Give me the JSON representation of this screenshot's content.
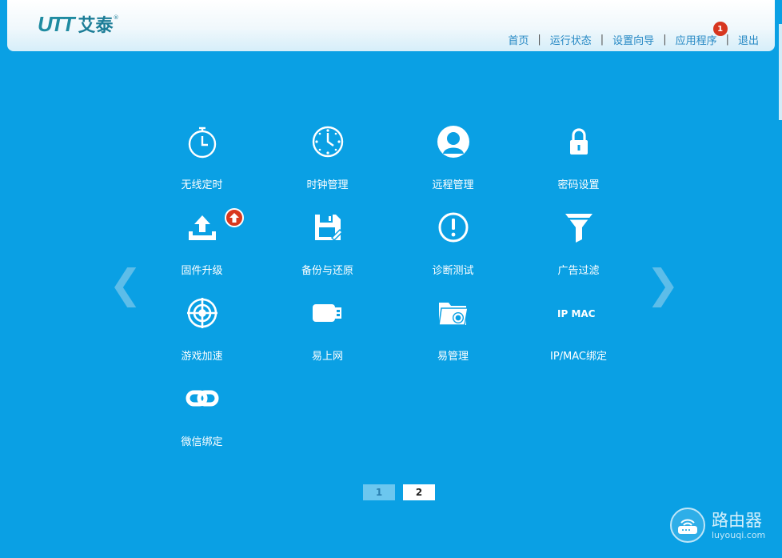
{
  "header": {
    "logo_mark": "UTT",
    "logo_text": "艾泰",
    "logo_reg": "®",
    "nav": [
      {
        "label": "首页"
      },
      {
        "label": "运行状态"
      },
      {
        "label": "设置向导"
      },
      {
        "label": "应用程序",
        "badge": "1"
      },
      {
        "label": "退出"
      }
    ]
  },
  "apps": [
    {
      "label": "无线定时",
      "icon": "stopwatch-icon"
    },
    {
      "label": "时钟管理",
      "icon": "clock-icon"
    },
    {
      "label": "远程管理",
      "icon": "user-icon"
    },
    {
      "label": "密码设置",
      "icon": "lock-icon"
    },
    {
      "label": "固件升级",
      "icon": "upload-icon"
    },
    {
      "label": "备份与还原",
      "icon": "floppy-icon"
    },
    {
      "label": "诊断测试",
      "icon": "exclamation-icon"
    },
    {
      "label": "广告过滤",
      "icon": "funnel-icon"
    },
    {
      "label": "游戏加速",
      "icon": "target-icon"
    },
    {
      "label": "易上网",
      "icon": "plug-icon"
    },
    {
      "label": "易管理",
      "icon": "folder-gear-icon"
    },
    {
      "label": "IP/MAC绑定",
      "icon": "ip-mac-icon",
      "icon_text": "IP MAC"
    },
    {
      "label": "微信绑定",
      "icon": "link-icon"
    }
  ],
  "nav_arrows": {
    "prev": "❮",
    "next": "❯"
  },
  "pagination": {
    "pages": [
      "1",
      "2"
    ],
    "current": "2"
  },
  "watermark": {
    "title": "路由器",
    "url": "luyouqi.com"
  },
  "colors": {
    "background": "#0aa0e4",
    "badge": "#d7361f"
  }
}
